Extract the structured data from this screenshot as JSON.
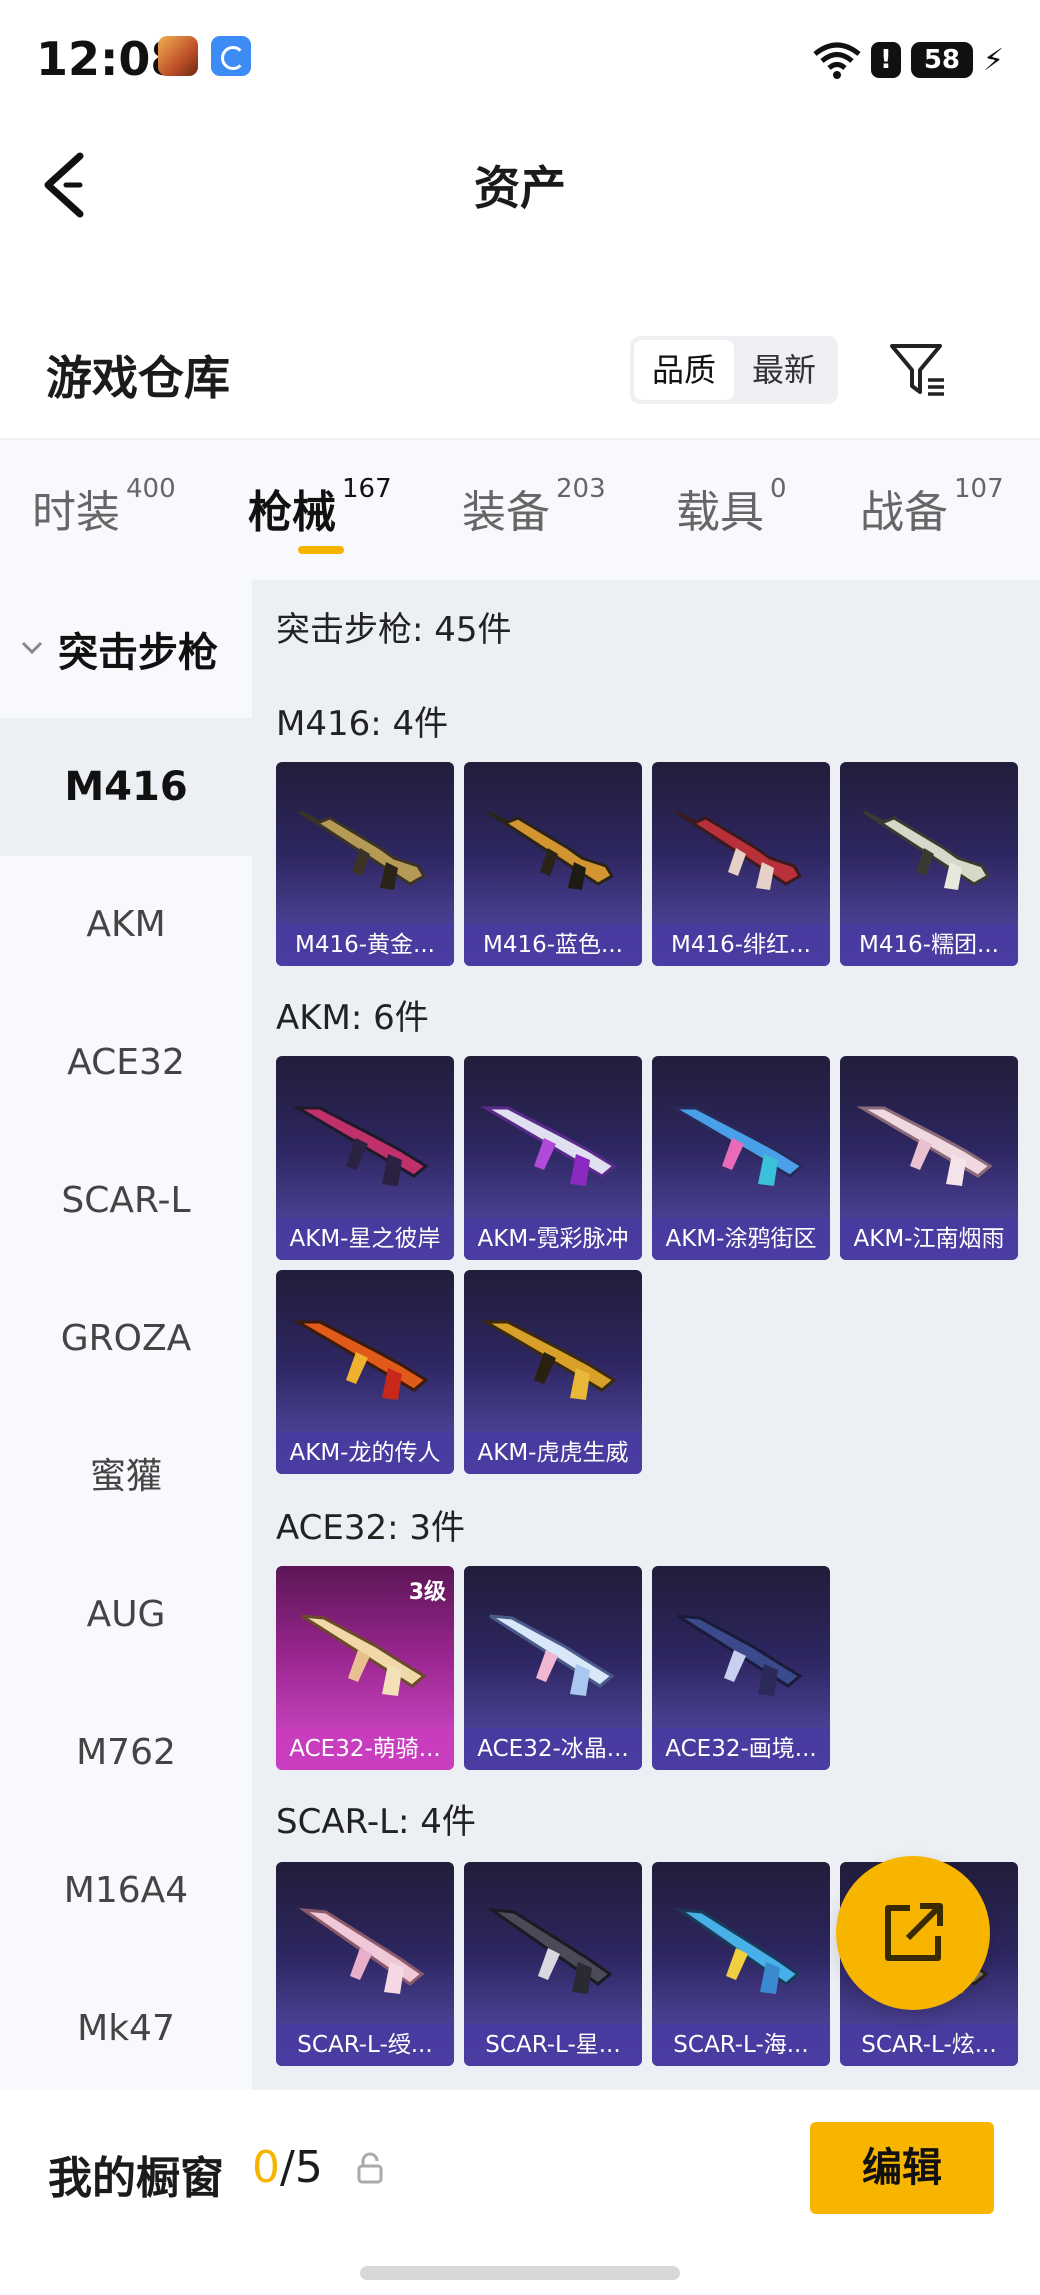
{
  "status_bar": {
    "time": "12:08",
    "battery": "58"
  },
  "header": {
    "title": "资产"
  },
  "section": {
    "title": "游戏仓库",
    "sort_options": [
      "品质",
      "最新"
    ],
    "sort_selected": "品质"
  },
  "tabs": [
    {
      "label": "时装",
      "count": "400"
    },
    {
      "label": "枪械",
      "count": "167",
      "selected": true
    },
    {
      "label": "装备",
      "count": "203"
    },
    {
      "label": "载具",
      "count": "0"
    },
    {
      "label": "战备",
      "count": "107"
    }
  ],
  "sidebar": {
    "group": "突击步枪",
    "items": [
      "M416",
      "AKM",
      "ACE32",
      "SCAR-L",
      "GROZA",
      "蜜獾",
      "AUG",
      "M762",
      "M16A4",
      "Mk47"
    ],
    "selected": "M416"
  },
  "content": {
    "summary": "突击步枪: 45件",
    "groups": [
      {
        "label": "M416: 4件",
        "items": [
          "M416-黄金...",
          "M416-蓝色...",
          "M416-绯红...",
          "M416-糯团..."
        ]
      },
      {
        "label": "AKM: 6件",
        "items": [
          "AKM-星之彼岸",
          "AKM-霓彩脉冲",
          "AKM-涂鸦街区",
          "AKM-江南烟雨",
          "AKM-龙的传人",
          "AKM-虎虎生威"
        ]
      },
      {
        "label": "ACE32: 3件",
        "items": [
          "ACE32-萌骑...",
          "ACE32-冰晶...",
          "ACE32-画境..."
        ],
        "first_item_level": "3级"
      },
      {
        "label": "SCAR-L: 4件",
        "items": [
          "SCAR-L-绶...",
          "SCAR-L-星...",
          "SCAR-L-海...",
          "SCAR-L-炫..."
        ]
      }
    ]
  },
  "bottom_bar": {
    "label": "我的橱窗",
    "used": "0",
    "total": "/5",
    "edit_label": "编辑"
  },
  "colors": {
    "accent": "#f7b500",
    "card_bg": "#2d2660",
    "card_caption": "#483aa0",
    "card_legendary": "#d94fd1"
  }
}
